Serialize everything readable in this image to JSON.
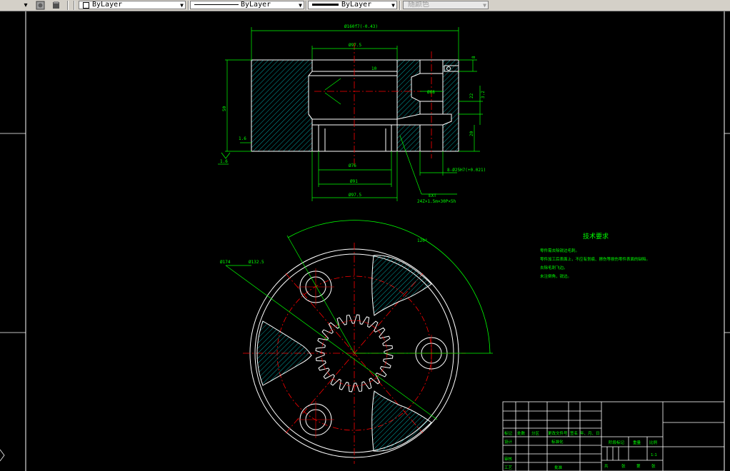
{
  "toolbar": {
    "layer_value": "ByLayer",
    "linetype_value": "ByLayer",
    "lineweight_value": "ByLayer",
    "plotstyle_value": "随颜色"
  },
  "colors": {
    "background": "#000000",
    "dimension": "#00ff00",
    "centerline": "#ff0000",
    "geometry": "#ffffff",
    "hatch": "#00cccc"
  },
  "drawing": {
    "dims_top": {
      "overall_diameter": "Ø160f7(-0.43)",
      "bore_top": "Ø97.5",
      "bore_mid": "Ø68",
      "bore_low": "Ø91",
      "bore_bottom": "Ø97.5",
      "height": "50",
      "thickness": "10",
      "step": "1.6",
      "right_small": "8",
      "right_mid": "22",
      "right_bottom": "20",
      "tolerance": "Ø76",
      "hole_callout": "8-Ø25H7(+0.021)",
      "spline_callout": "EXT",
      "spline_code": "24Z×1.5m×30P×5h",
      "roughness_left": "1.6",
      "roughness_right": "3.2"
    },
    "dims_plan": {
      "angle": "120°",
      "pcd_outer": "Ø174",
      "pcd_inner": "Ø132.5"
    },
    "tech_req": {
      "title": "技术要求",
      "lines": [
        "零件需去除锐边毛刺。",
        "零件加工后表面上，不应有划痕、擦伤等损伤零件表面的缺陷。",
        "去除毛刺飞边。",
        "未注倒角，锐边。"
      ]
    },
    "title_block": {
      "h_mark": "标记",
      "h_count": "处数",
      "h_zone": "分区",
      "h_doc": "更改文件号",
      "h_sign": "签名",
      "h_date": "年、月、日",
      "r_design": "设计",
      "r_standard": "标准化",
      "r_review": "审核",
      "r_process": "工艺",
      "r_approve": "批准",
      "stage_mark": "阶段标记",
      "weight": "重量",
      "scale": "比例",
      "scale_value": "1:1",
      "sheets_total": "共",
      "sheets_zhang": "张",
      "sheets_di": "第",
      "sheets_zhang2": "张"
    }
  }
}
